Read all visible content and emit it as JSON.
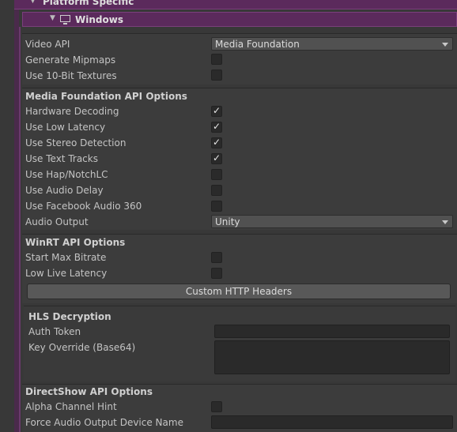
{
  "header": {
    "platform_label": "Platform Specific",
    "windows_label": "Windows"
  },
  "video_api": {
    "label": "Video API",
    "value": "Media Foundation"
  },
  "generate_mipmaps": {
    "label": "Generate Mipmaps",
    "checked": false
  },
  "use_10bit": {
    "label": "Use 10-Bit Textures",
    "checked": false
  },
  "mf_section": {
    "title": "Media Foundation API Options",
    "items": [
      {
        "label": "Hardware Decoding",
        "checked": true
      },
      {
        "label": "Use Low Latency",
        "checked": true
      },
      {
        "label": "Use Stereo Detection",
        "checked": true
      },
      {
        "label": "Use Text Tracks",
        "checked": true
      },
      {
        "label": "Use Hap/NotchLC",
        "checked": false
      },
      {
        "label": "Use Audio Delay",
        "checked": false
      },
      {
        "label": "Use Facebook Audio 360",
        "checked": false
      }
    ],
    "audio_output_label": "Audio Output",
    "audio_output_value": "Unity"
  },
  "winrt_section": {
    "title": "WinRT API Options",
    "items": [
      {
        "label": "Start Max Bitrate",
        "checked": false
      },
      {
        "label": "Low Live Latency",
        "checked": false
      }
    ],
    "http_button": "Custom HTTP Headers"
  },
  "hls_section": {
    "title": "HLS Decryption",
    "auth_token_label": "Auth Token",
    "auth_token_value": "",
    "key_override_label": "Key Override (Base64)",
    "key_override_value": ""
  },
  "directshow_section": {
    "title": "DirectShow API Options",
    "alpha_hint_label": "Alpha Channel Hint",
    "alpha_hint_checked": false,
    "force_audio_label": "Force Audio Output Device Name",
    "force_audio_value": ""
  },
  "colors": {
    "header_purple": "#5b2a5c",
    "panel_bg": "#3c3c3c",
    "checkbox_bg": "#2a2a2a"
  }
}
